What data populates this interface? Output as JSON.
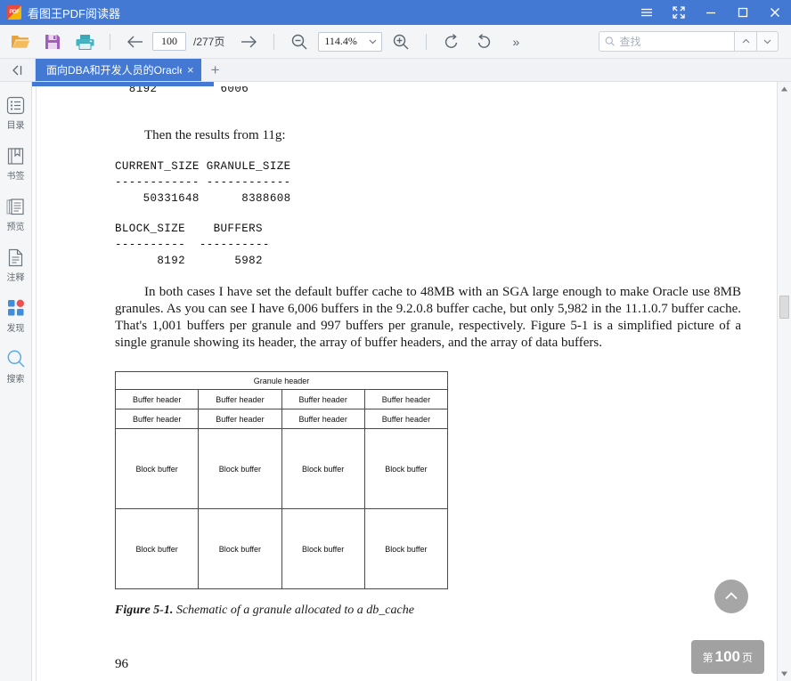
{
  "window": {
    "app_title": "看图王PDF阅读器",
    "logo_text": "PDF",
    "controls": {
      "menu": "menu-icon",
      "fullscreen": "fullscreen-icon",
      "minimize": "minimize-icon",
      "maximize": "maximize-icon",
      "close": "close-icon"
    }
  },
  "toolbar": {
    "open_label": "打开",
    "save_label": "保存",
    "print_label": "打印",
    "prev_page_label": "上一页",
    "next_page_label": "下一页",
    "current_page": "100",
    "page_total": "/277页",
    "zoom_out_label": "缩小",
    "zoom_in_label": "放大",
    "zoom_value": "114.4%",
    "rotate_left_label": "左旋转",
    "rotate_right_label": "右旋转",
    "more_label": "»",
    "search_placeholder": "查找",
    "search_value": "",
    "search_prev": "︿",
    "search_next": "﹀"
  },
  "tabs": {
    "collapse_label": "收起",
    "items": [
      {
        "label": "面向DBA和开发人员的Oracle核",
        "close": "×",
        "active": true
      }
    ],
    "new_tab_label": "+"
  },
  "sidebar": {
    "items": [
      {
        "label": "目录",
        "icon": "list-icon"
      },
      {
        "label": "书签",
        "icon": "bookmark-icon"
      },
      {
        "label": "预览",
        "icon": "thumbnails-icon"
      },
      {
        "label": "注释",
        "icon": "annotation-icon"
      },
      {
        "label": "发现",
        "icon": "discover-icon"
      },
      {
        "label": "搜索",
        "icon": "search-icon"
      }
    ]
  },
  "document": {
    "code_top_clipped": "  8192         6006",
    "line_11g": "Then the results from 11g:",
    "line_11g_italic": "g",
    "code_block_1": "CURRENT_SIZE GRANULE_SIZE\n------------ ------------\n    50331648      8388608",
    "code_block_2": "BLOCK_SIZE    BUFFERS\n----------  ----------\n      8192       5982",
    "paragraph": "In both cases I have set the default buffer cache to 48MB with an SGA large enough to make Oracle use 8MB granules. As you can see I have 6,006 buffers in the 9.2.0.8 buffer cache, but only 5,982 in the 11.1.0.7 buffer cache. That's 1,001 buffers per granule and 997 buffers per granule, respectively. Figure 5-1 is a simplified picture of a single granule showing its header, the array of buffer headers, and the array of data buffers.",
    "figure": {
      "granule_header": "Granule header",
      "buffer_header": "Buffer header",
      "block_buffer": "Block buffer",
      "buffer_header_rows": 2,
      "block_buffer_rows": 2,
      "columns": 4
    },
    "figure_caption_bold": "Figure 5-1.",
    "figure_caption_rest": " Schematic of a granule allocated to a db_cache",
    "page_number": "96"
  },
  "overlays": {
    "scroll_top_label": "回到顶部",
    "page_badge_prefix": "第",
    "page_badge_number": "100",
    "page_badge_suffix": "页"
  },
  "scrollbar": {
    "up_label": "向上",
    "down_label": "向下"
  },
  "colors": {
    "title_bar": "#4479d3",
    "toolbar_bg": "#f3f5f7",
    "tab_active": "#4479d3",
    "sidebar_bg": "#f5f6f8",
    "overlay_gray": "#9a9a9a"
  }
}
